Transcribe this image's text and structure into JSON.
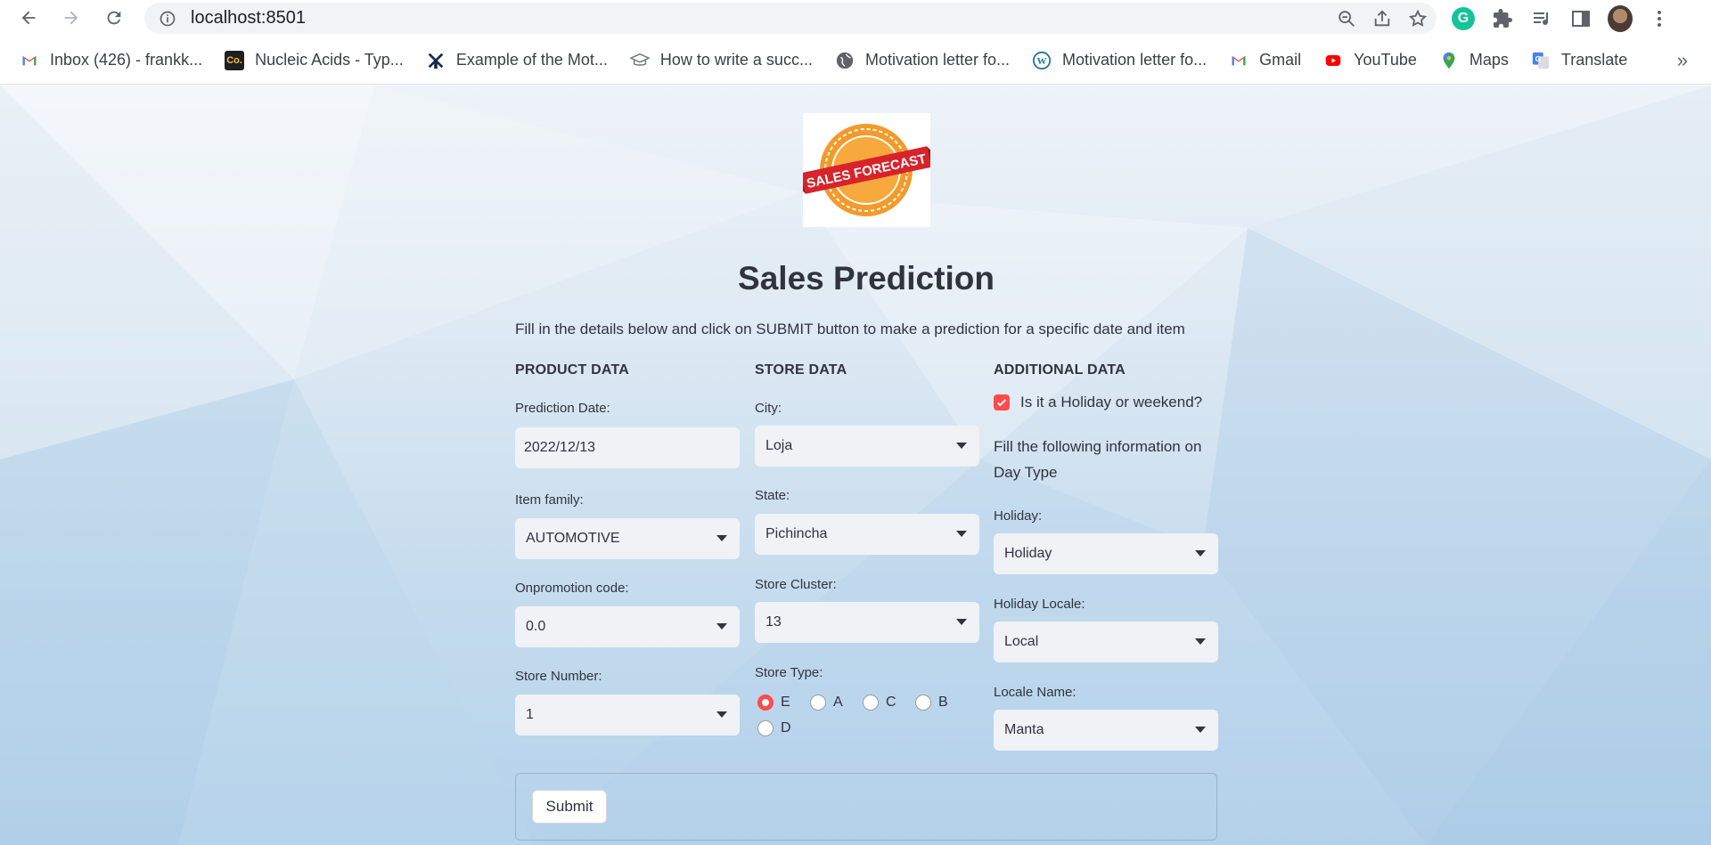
{
  "browser": {
    "url": "localhost:8501",
    "bookmarks": [
      {
        "label": "Inbox (426) - frankk...",
        "icon": "gmail-icon"
      },
      {
        "label": "Nucleic Acids - Typ...",
        "icon": "course-icon"
      },
      {
        "label": "Example of the Mot...",
        "icon": "windmill-icon"
      },
      {
        "label": "How to write a succ...",
        "icon": "graduation-cap-icon"
      },
      {
        "label": "Motivation letter fo...",
        "icon": "globe-icon"
      },
      {
        "label": "Motivation letter fo...",
        "icon": "wordpress-icon"
      },
      {
        "label": "Gmail",
        "icon": "gmail-icon"
      },
      {
        "label": "YouTube",
        "icon": "youtube-icon"
      },
      {
        "label": "Maps",
        "icon": "maps-icon"
      },
      {
        "label": "Translate",
        "icon": "translate-icon"
      }
    ],
    "more_label": "»"
  },
  "app": {
    "logo_text": "SALES FORECAST",
    "title": "Sales Prediction",
    "subtitle": "Fill in the details below and click on SUBMIT button to make a prediction for a specific date and item",
    "product": {
      "heading": "PRODUCT DATA",
      "date_label": "Prediction Date:",
      "date_value": "2022/12/13",
      "family_label": "Item family:",
      "family_value": "AUTOMOTIVE",
      "promo_label": "Onpromotion code:",
      "promo_value": "0.0",
      "store_label": "Store Number:",
      "store_value": "1"
    },
    "store": {
      "heading": "STORE DATA",
      "city_label": "City:",
      "city_value": "Loja",
      "state_label": "State:",
      "state_value": "Pichincha",
      "cluster_label": "Store Cluster:",
      "cluster_value": "13",
      "type_label": "Store Type:",
      "type_options": [
        "E",
        "A",
        "C",
        "B",
        "D"
      ],
      "type_selected": "E"
    },
    "additional": {
      "heading": "ADDITIONAL DATA",
      "holiday_check_label": "Is it a Holiday or weekend?",
      "holiday_checked": true,
      "info_text": "Fill the following information on Day Type",
      "holiday_label": "Holiday:",
      "holiday_value": "Holiday",
      "locale_label": "Holiday Locale:",
      "locale_value": "Local",
      "locale_name_label": "Locale Name:",
      "locale_name_value": "Manta"
    },
    "submit_label": "Submit"
  },
  "colors": {
    "accent": "#ff4b4b",
    "input_bg": "#f0f2f6",
    "text": "#31333f"
  }
}
